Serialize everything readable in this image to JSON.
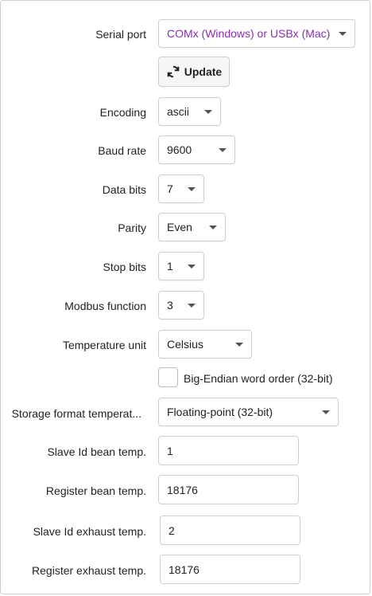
{
  "form": {
    "serial_port": {
      "label": "Serial port",
      "value": "COMx (Windows) or USBx (Mac)"
    },
    "update_button": {
      "label": "Update",
      "icon": "refresh-icon"
    },
    "encoding": {
      "label": "Encoding",
      "value": "ascii"
    },
    "baud_rate": {
      "label": "Baud rate",
      "value": "9600"
    },
    "data_bits": {
      "label": "Data bits",
      "value": "7"
    },
    "parity": {
      "label": "Parity",
      "value": "Even"
    },
    "stop_bits": {
      "label": "Stop bits",
      "value": "1"
    },
    "modbus_function": {
      "label": "Modbus function",
      "value": "3"
    },
    "temperature_unit": {
      "label": "Temperature unit",
      "value": "Celsius"
    },
    "big_endian": {
      "label": "Big-Endian word order (32-bit)",
      "checked": false
    },
    "storage_format": {
      "label": "Storage format temperat...",
      "value": "Floating-point (32-bit)"
    },
    "slave_id_bean": {
      "label": "Slave Id bean temp.",
      "value": "1"
    },
    "register_bean": {
      "label": "Register bean temp.",
      "value": "18176"
    },
    "slave_id_exhaust": {
      "label": "Slave Id exhaust temp.",
      "value": "2"
    },
    "register_exhaust": {
      "label": "Register exhaust temp.",
      "value": "18176"
    }
  },
  "colors": {
    "accent": "#8a2db5",
    "border": "#cfcfcf"
  }
}
